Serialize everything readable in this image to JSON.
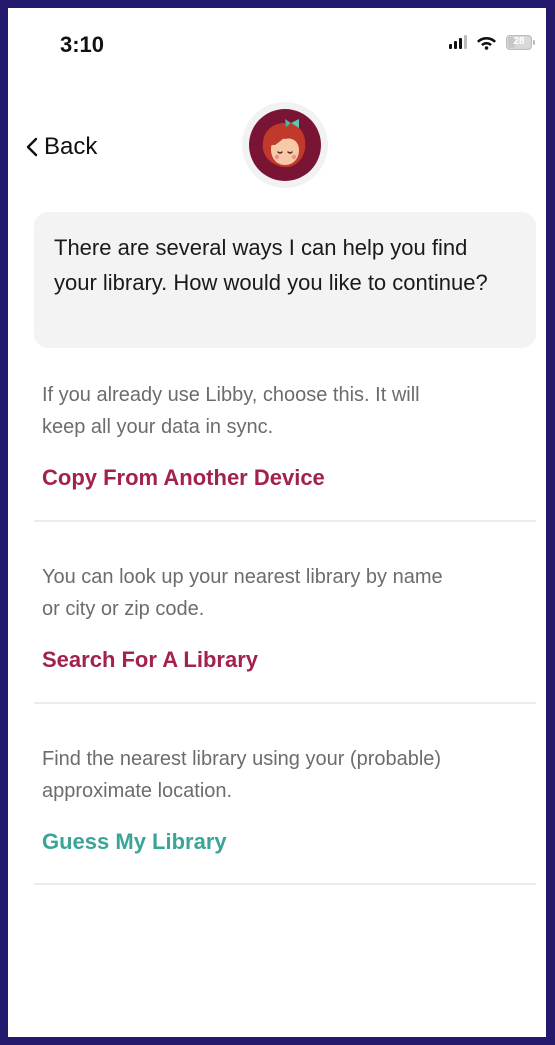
{
  "status_bar": {
    "time": "3:10",
    "battery": "28",
    "battery_level": 0.28,
    "icons": [
      "cellular-signal-icon",
      "wifi-icon",
      "battery-icon"
    ]
  },
  "nav": {
    "back_label": "Back",
    "back_icon": "chevron-left-icon"
  },
  "assistant": {
    "avatar_icon": "libby-avatar-icon",
    "message": "There are several ways I can help you find your library. How would you like to continue?"
  },
  "options": [
    {
      "description": "If you already use Libby, choose this. It will keep all your data in sync.",
      "action": "Copy From Another Device",
      "action_color": "#a2214f"
    },
    {
      "description": "You can look up your nearest library by name or city or zip code.",
      "action": "Search For A Library",
      "action_color": "#a2214f"
    },
    {
      "description": "Find the nearest library using your (probable) approximate location.",
      "action": "Guess My Library",
      "action_color": "#3aa597"
    }
  ],
  "colors": {
    "frame": "#231a6e",
    "accent": "#a2214f",
    "teal": "#3aa597",
    "avatar_bg": "#7a1434"
  }
}
